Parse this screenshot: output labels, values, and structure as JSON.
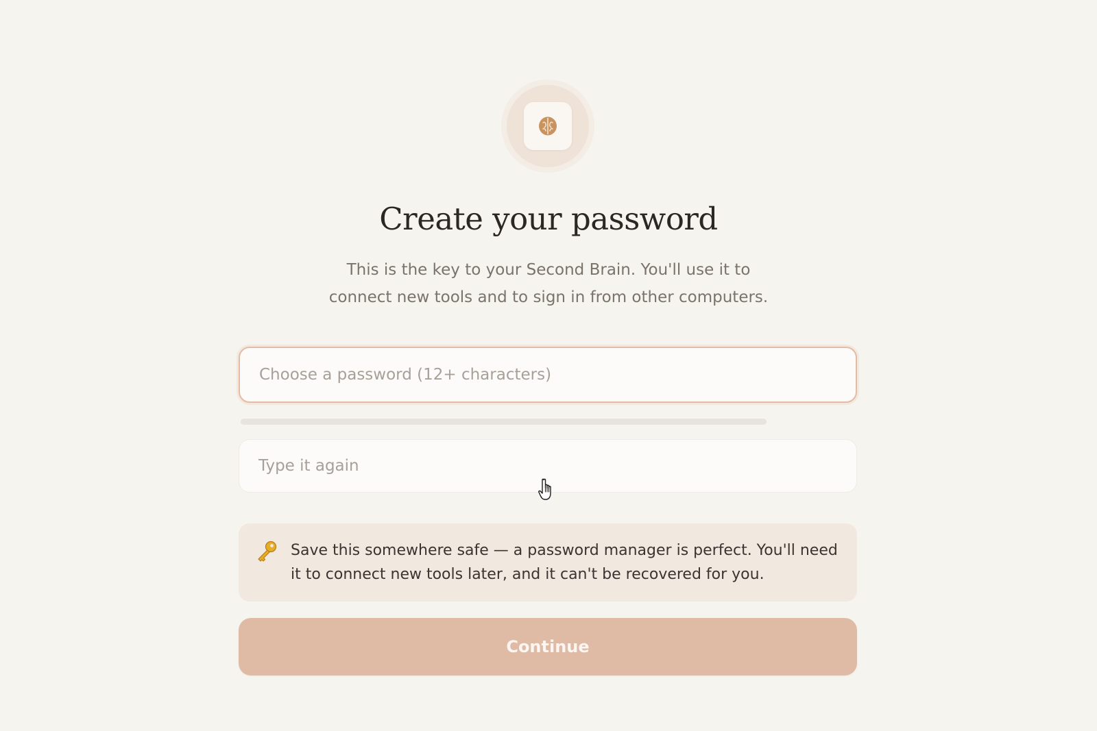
{
  "logo": {
    "icon": "brain-icon",
    "accent": "#c8935f"
  },
  "heading": {
    "title": "Create your password",
    "subtitle_line1": "This is the key to your Second Brain. You'll use it to",
    "subtitle_line2": "connect new tools and to sign in from other computers."
  },
  "password_field": {
    "value": "",
    "placeholder": "Choose a password (12+ characters)"
  },
  "strength": {
    "level_percent": 0
  },
  "confirm_field": {
    "value": "",
    "placeholder": "Type it again"
  },
  "notice": {
    "icon": "key-icon",
    "text_line1": "Save this somewhere safe — a password manager is perfect. You'll need",
    "text_line2": "it to connect new tools later, and it can't be recovered for you."
  },
  "continue_button": {
    "label": "Continue",
    "state": "disabled"
  },
  "colors": {
    "background": "#f6f4ef",
    "accent": "#dfbba6",
    "focus_border": "#e3bca5",
    "notice_background": "#f1e8e0"
  }
}
